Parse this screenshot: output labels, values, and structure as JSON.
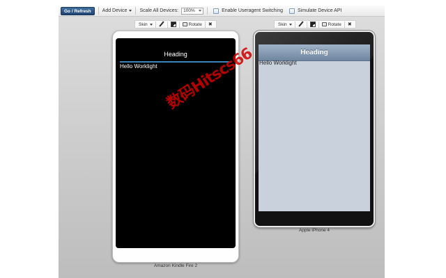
{
  "toolbar": {
    "go_label": "Go / Refresh",
    "add_device_label": "Add Device",
    "scale_label": "Scale All Devices:",
    "scale_value": "100%",
    "useragent_label": "Enable Useragent Switching",
    "simulate_label": "Simulate Device API"
  },
  "device_controls": {
    "skin_label": "Skin",
    "rotate_label": "Rotate",
    "close_glyph": "✖"
  },
  "devices": [
    {
      "name": "Amazon Kindle Fire 2",
      "heading": "Heading",
      "body_text": "Hello Worklight"
    },
    {
      "name": "Apple iPhone 4",
      "heading": "Heading",
      "body_text": "Hello Worklight"
    }
  ],
  "watermark": "数码Hitscs66",
  "colors": {
    "go_button": "#1f4370",
    "kindle_accent_line": "#3b83b8",
    "iphone_header": "#7f95ad",
    "iphone_screen_bg": "#c9d2dc",
    "watermark": "#d10000"
  },
  "icons": [
    "caret-down-icon",
    "checkbox-icon",
    "pencil-icon",
    "qr-code-icon",
    "rotate-icon",
    "close-icon"
  ]
}
